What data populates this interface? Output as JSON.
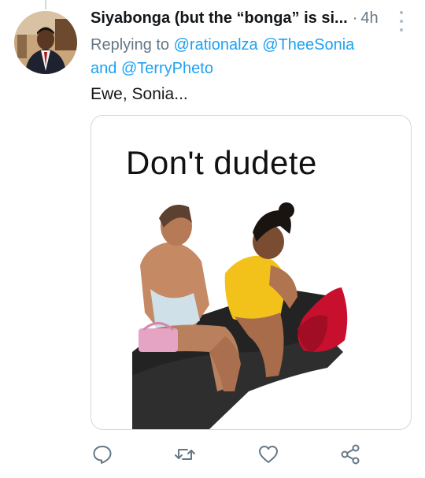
{
  "tweet": {
    "display_name": "Siyabonga (but the “bonga” is si...",
    "separator": "·",
    "time": "4h",
    "replying_prefix": "Replying to",
    "mentions": [
      "@rationalza",
      "@TheeSonia",
      "@TerryPheto"
    ],
    "mention_joiner": "and",
    "text": "Ewe, Sonia..."
  },
  "media": {
    "caption": "Don't dudete"
  },
  "icons": {
    "more": "more-vertical-icon",
    "reply": "reply-icon",
    "retweet": "retweet-icon",
    "like": "heart-icon",
    "share": "share-icon"
  },
  "colors": {
    "mention": "#1da1f2",
    "secondary_text": "#657786",
    "icon": "#657786"
  }
}
